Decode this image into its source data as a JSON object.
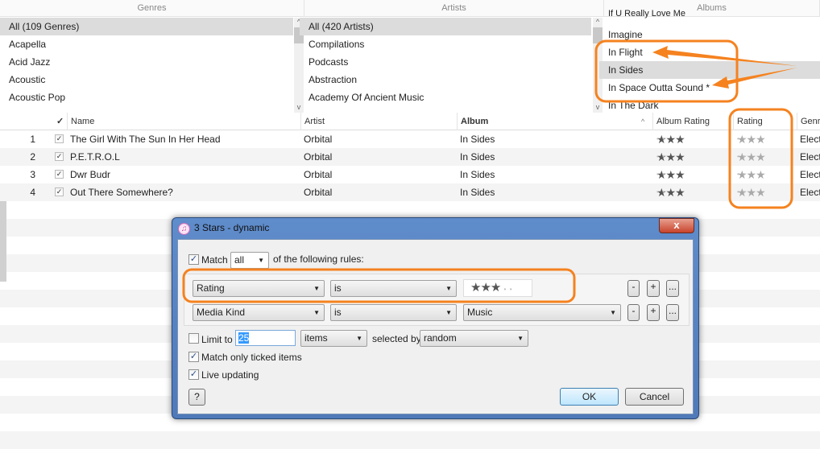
{
  "browser": {
    "genres": {
      "header": "Genres",
      "items": [
        "All (109 Genres)",
        "Acapella",
        "Acid Jazz",
        "Acoustic",
        "Acoustic Pop"
      ]
    },
    "artists": {
      "header": "Artists",
      "items": [
        "All (420 Artists)",
        "Compilations",
        "Podcasts",
        "Abstraction",
        "Academy Of Ancient Music"
      ]
    },
    "albums": {
      "header": "Albums",
      "items": [
        "If U Really Love Me",
        "Imagine",
        "In Flight",
        "In Sides",
        "In Space Outta Sound *",
        "In The Dark"
      ]
    }
  },
  "tracks": {
    "columns": {
      "check": "✓",
      "name": "Name",
      "artist": "Artist",
      "album": "Album",
      "album_rating": "Album Rating",
      "rating": "Rating",
      "genre": "Genre"
    },
    "rows": [
      {
        "num": "1",
        "name": "The Girl With The Sun In Her Head",
        "artist": "Orbital",
        "album": "In Sides",
        "album_rating": 3,
        "rating": 3,
        "genre": "Electronic"
      },
      {
        "num": "2",
        "name": "P.E.T.R.O.L",
        "artist": "Orbital",
        "album": "In Sides",
        "album_rating": 3,
        "rating": 3,
        "genre": "Electronic"
      },
      {
        "num": "3",
        "name": "Dwr Budr",
        "artist": "Orbital",
        "album": "In Sides",
        "album_rating": 3,
        "rating": 3,
        "genre": "Electronic"
      },
      {
        "num": "4",
        "name": "Out There Somewhere?",
        "artist": "Orbital",
        "album": "In Sides",
        "album_rating": 3,
        "rating": 3,
        "genre": "Electronic"
      }
    ]
  },
  "dialog": {
    "title": "3 Stars - dynamic",
    "close": "x",
    "match_label": "Match",
    "match_value": "all",
    "match_suffix": "of the following rules:",
    "rules": [
      {
        "field": "Rating",
        "op": "is",
        "value_stars": 3
      },
      {
        "field": "Media Kind",
        "op": "is",
        "value": "Music"
      }
    ],
    "rule_buttons": {
      "remove": "-",
      "add": "+",
      "more": "..."
    },
    "limit_label": "Limit to",
    "limit_value": "25",
    "limit_unit": "items",
    "selected_by_label": "selected by",
    "selected_by": "random",
    "match_ticked": "Match only ticked items",
    "live_updating": "Live updating",
    "help": "?",
    "ok": "OK",
    "cancel": "Cancel"
  },
  "colors": {
    "annotation": "#f5821f",
    "title_bar": "#5f8ccb"
  }
}
